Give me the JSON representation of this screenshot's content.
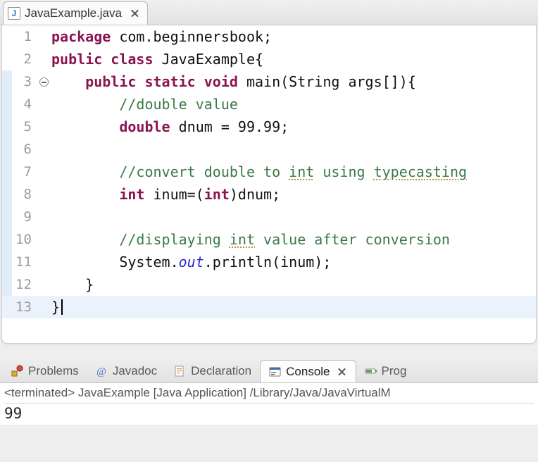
{
  "editor": {
    "tab_title": "JavaExample.java",
    "lines": [
      {
        "n": "1",
        "fold": false,
        "hl": false,
        "marker": false,
        "html": "<span class='kw'>package</span> com.beginnersbook;"
      },
      {
        "n": "2",
        "fold": false,
        "hl": false,
        "marker": false,
        "html": "<span class='kw'>public</span> <span class='kw'>class</span> JavaExample{"
      },
      {
        "n": "3",
        "fold": true,
        "hl": false,
        "marker": true,
        "html": "    <span class='kw'>public</span> <span class='kw'>static</span> <span class='kw'>void</span> main(String args[]){"
      },
      {
        "n": "4",
        "fold": true,
        "hl": false,
        "marker": false,
        "html": "        <span class='cm'>//double value</span>"
      },
      {
        "n": "5",
        "fold": true,
        "hl": false,
        "marker": false,
        "html": "        <span class='kw'>double</span> dnum = 99.99;"
      },
      {
        "n": "6",
        "fold": true,
        "hl": false,
        "marker": false,
        "html": ""
      },
      {
        "n": "7",
        "fold": true,
        "hl": false,
        "marker": false,
        "html": "        <span class='cm'>//convert double to <span class='wave'>int</span> using <span class='wave'>typecasting</span></span>"
      },
      {
        "n": "8",
        "fold": true,
        "hl": false,
        "marker": false,
        "html": "        <span class='kw'>int</span> inum=(<span class='kw'>int</span>)dnum;"
      },
      {
        "n": "9",
        "fold": true,
        "hl": false,
        "marker": false,
        "html": ""
      },
      {
        "n": "10",
        "fold": true,
        "hl": false,
        "marker": false,
        "html": "        <span class='cm'>//displaying <span class='wave'>int</span> value after conversion</span>"
      },
      {
        "n": "11",
        "fold": true,
        "hl": false,
        "marker": false,
        "html": "        System.<span class='it'>out</span>.println(inum);"
      },
      {
        "n": "12",
        "fold": true,
        "hl": false,
        "marker": false,
        "html": "    }"
      },
      {
        "n": "13",
        "fold": false,
        "hl": true,
        "marker": false,
        "html": "}<span class='cursor'></span>"
      }
    ]
  },
  "panel": {
    "tabs": {
      "problems": "Problems",
      "javadoc": "Javadoc",
      "declaration": "Declaration",
      "console": "Console",
      "progress": "Prog"
    },
    "status": "<terminated> JavaExample [Java Application] /Library/Java/JavaVirtualM",
    "output": "99"
  }
}
